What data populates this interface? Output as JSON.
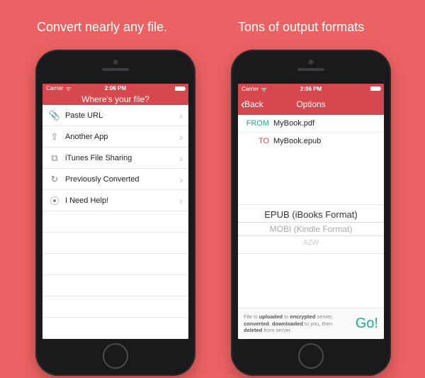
{
  "captions": {
    "left": "Convert nearly any file.",
    "right": "Tons of output formats"
  },
  "statusbar": {
    "carrier": "Carrier",
    "time": "2:06 PM"
  },
  "left_screen": {
    "title": "Where's your file?",
    "rows": [
      {
        "icon": "paperclip-icon",
        "glyph": "📎",
        "label": "Paste URL"
      },
      {
        "icon": "share-icon",
        "glyph": "⇪",
        "label": "Another App"
      },
      {
        "icon": "stack-icon",
        "glyph": "⧉",
        "label": "iTunes File Sharing"
      },
      {
        "icon": "history-icon",
        "glyph": "↻",
        "label": "Previously Converted"
      },
      {
        "icon": "help-icon",
        "glyph": "⦿",
        "label": "I Need Help!"
      }
    ]
  },
  "right_screen": {
    "back": "Back",
    "title": "Options",
    "from_label": "FROM",
    "to_label": "TO",
    "from_value": "MyBook.pdf",
    "to_value": "MyBook.epub",
    "picker": {
      "selected": "EPUB (iBooks Format)",
      "below1": "MOBI (Kindle Format)",
      "below2": "AZW"
    },
    "footer_note_parts": {
      "p1": "File is ",
      "b1": "uploaded",
      "p2": " to ",
      "b2": "encrypted",
      "p3": " server, ",
      "b3": "converted",
      "p4": ", ",
      "b4": "downloaded",
      "p5": " to you, then ",
      "b5": "deleted",
      "p6": " from server."
    },
    "go": "Go!"
  }
}
